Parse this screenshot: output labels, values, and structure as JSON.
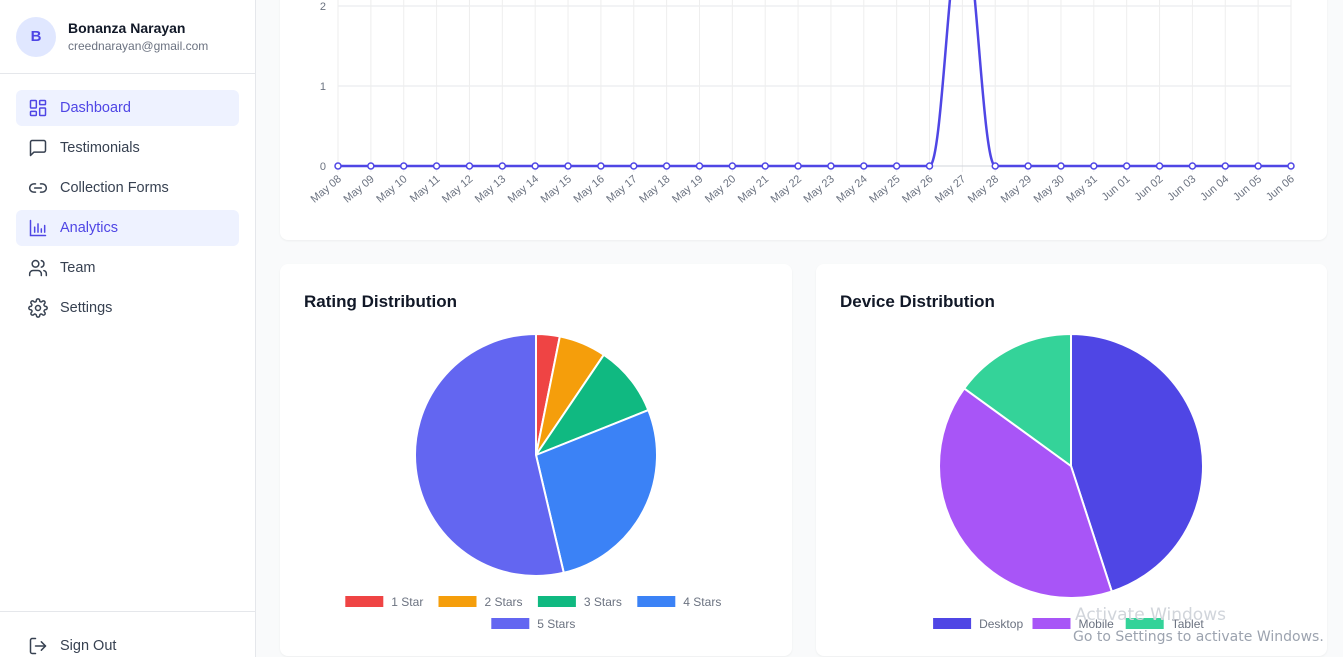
{
  "user": {
    "initial": "B",
    "name": "Bonanza Narayan",
    "email": "creednarayan@gmail.com"
  },
  "nav": {
    "items": [
      {
        "label": "Dashboard",
        "icon": "dashboard-grid-icon"
      },
      {
        "label": "Testimonials",
        "icon": "message-square-icon"
      },
      {
        "label": "Collection Forms",
        "icon": "link-icon"
      },
      {
        "label": "Analytics",
        "icon": "bar-chart-icon"
      },
      {
        "label": "Team",
        "icon": "users-icon"
      },
      {
        "label": "Settings",
        "icon": "gear-icon"
      }
    ],
    "signout_label": "Sign Out",
    "signout_icon": "log-out-icon"
  },
  "rating_card": {
    "title": "Rating Distribution"
  },
  "device_card": {
    "title": "Device Distribution"
  },
  "watermark": {
    "line1": "Activate Windows",
    "line2": "Go to Settings to activate Windows."
  },
  "colors": {
    "accent": "#4f46e5",
    "line": "#4f46e5"
  },
  "chart_data": [
    {
      "type": "line",
      "x": [
        "May 08",
        "May 09",
        "May 10",
        "May 11",
        "May 12",
        "May 13",
        "May 14",
        "May 15",
        "May 16",
        "May 17",
        "May 18",
        "May 19",
        "May 20",
        "May 21",
        "May 22",
        "May 23",
        "May 24",
        "May 25",
        "May 26",
        "May 27",
        "May 28",
        "May 29",
        "May 30",
        "May 31",
        "Jun 01",
        "Jun 02",
        "Jun 03",
        "Jun 04",
        "Jun 05",
        "Jun 06"
      ],
      "series": [
        {
          "values": [
            0,
            0,
            0,
            0,
            0,
            0,
            0,
            0,
            0,
            0,
            0,
            0,
            0,
            0,
            0,
            0,
            0,
            0,
            0,
            3,
            0,
            0,
            0,
            0,
            0,
            0,
            0,
            0,
            0,
            0
          ],
          "color": "#4f46e5"
        }
      ],
      "yticks": [
        0,
        1,
        2
      ],
      "grid": true
    },
    {
      "type": "pie",
      "title": "Rating Distribution",
      "categories": [
        "1 Star",
        "2 Stars",
        "3 Stars",
        "4 Stars",
        "5 Stars"
      ],
      "values": [
        3,
        6,
        9,
        26,
        51
      ],
      "colors": [
        "#ef4444",
        "#f59e0b",
        "#10b981",
        "#3b82f6",
        "#6366f1"
      ],
      "legend": "bottom"
    },
    {
      "type": "pie",
      "title": "Device Distribution",
      "categories": [
        "Desktop",
        "Mobile",
        "Tablet"
      ],
      "values": [
        45,
        40,
        15
      ],
      "colors": [
        "#4f46e5",
        "#a855f7",
        "#34d399"
      ],
      "legend": "bottom"
    }
  ]
}
